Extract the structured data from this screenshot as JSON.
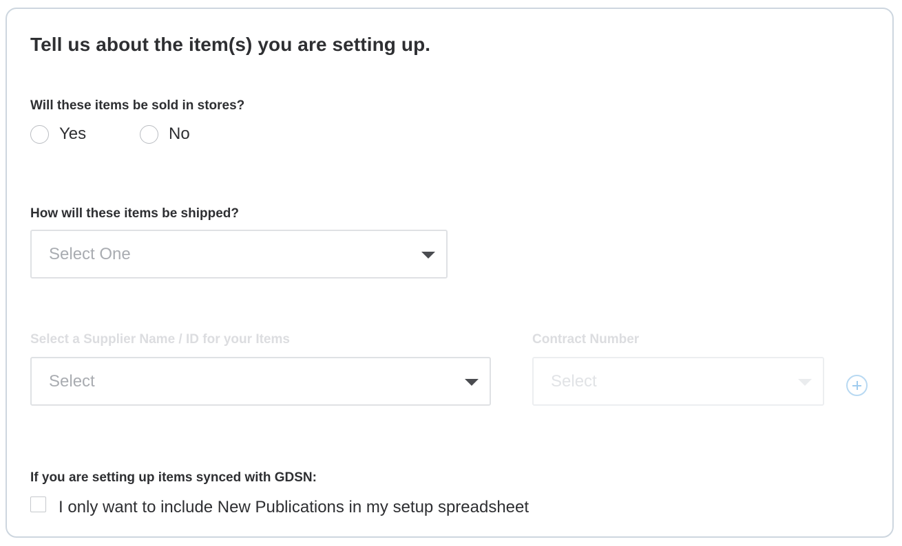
{
  "form": {
    "title": "Tell us about the item(s) you are setting up.",
    "sold_in_stores": {
      "label": "Will these items be sold in stores?",
      "options": [
        "Yes",
        "No"
      ],
      "selected": null
    },
    "shipping": {
      "label": "How will these items be shipped?",
      "placeholder": "Select One",
      "value": ""
    },
    "supplier": {
      "label": "Select a Supplier Name / ID for your Items",
      "placeholder": "Select",
      "value": "",
      "disabled": true
    },
    "contract": {
      "label": "Contract Number",
      "placeholder": "Select",
      "value": "",
      "disabled": true
    },
    "gdsn": {
      "label": "If you are setting up items synced with GDSN:",
      "checkbox_label": "I only want to include New Publications in my setup spreadsheet",
      "checked": false
    }
  },
  "icons": {
    "dropdown": "chevron-down-icon",
    "add": "plus-circle-icon"
  },
  "colors": {
    "text": "#2e2f32",
    "border": "#cdd6df",
    "disabled_text": "#dcdde0",
    "add_icon": "#9fcbee"
  }
}
